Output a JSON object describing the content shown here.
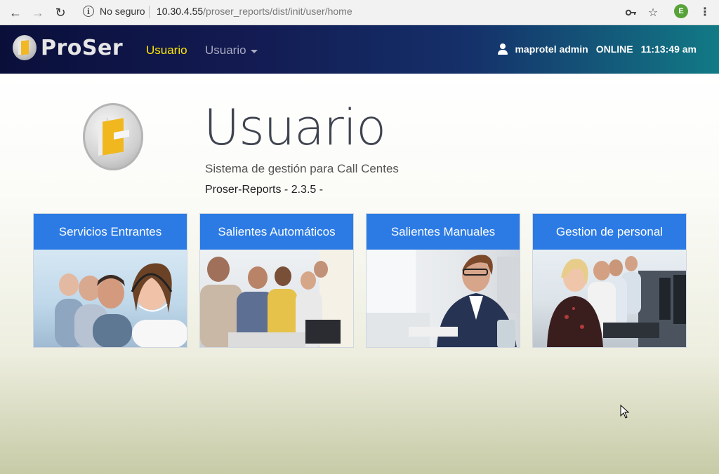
{
  "browser": {
    "security_label": "No seguro",
    "url_host": "10.30.4.55",
    "url_path": "/proser_reports/dist/init/user/home",
    "profile_initial": "E"
  },
  "navbar": {
    "brand": "ProSer",
    "active_link": "Usuario",
    "dropdown_label": "Usuario",
    "user_name": "maprotel admin",
    "status": "ONLINE",
    "clock": "11:13:49 am",
    "colors": {
      "active": "#ffe600",
      "gradient_start": "#0a0f3a",
      "gradient_end": "#127a86"
    }
  },
  "main": {
    "title": "Usuario",
    "subtitle": "Sistema de gestión para Call Centes",
    "version": "Proser-Reports - 2.3.5 -",
    "cards": [
      {
        "label": "Servicios Entrantes",
        "image": "call-center-agents-headset-photo"
      },
      {
        "label": "Salientes Automáticos",
        "image": "agents-row-at-computers-photo"
      },
      {
        "label": "Salientes Manuales",
        "image": "businessman-headset-desk-photo"
      },
      {
        "label": "Gestion de personal",
        "image": "call-center-team-monitors-photo"
      }
    ],
    "accent": "#2c7be5"
  }
}
